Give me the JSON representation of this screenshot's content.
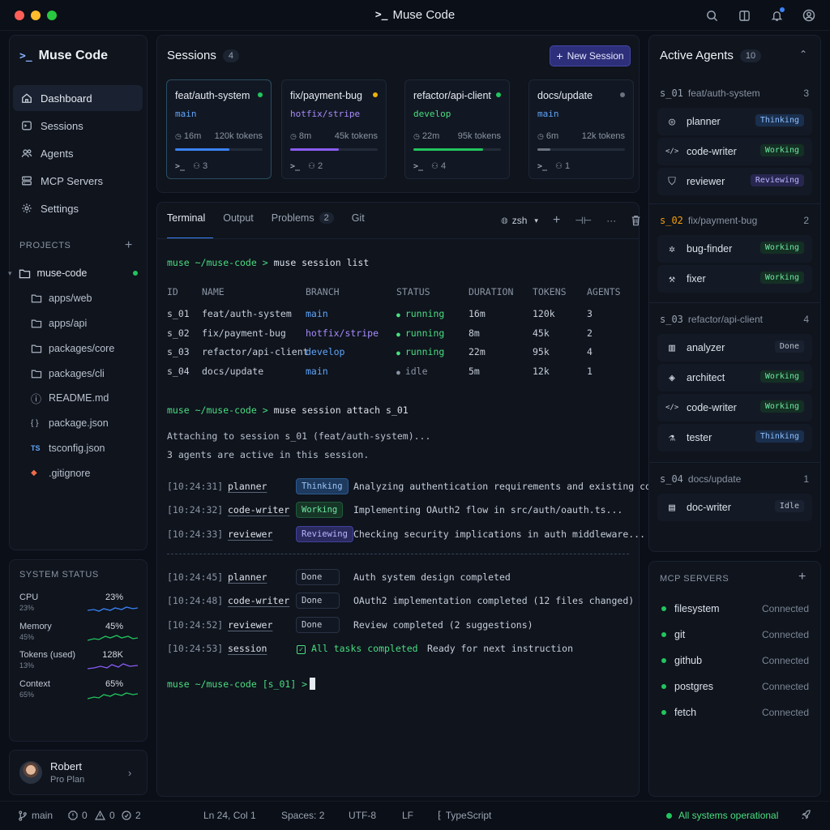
{
  "app": {
    "title": "Muse Code",
    "brand": "Muse Code"
  },
  "colors": {
    "accent": "#3b82f6",
    "green": "#22c55e",
    "yellow": "#eab308",
    "purple": "#8b5cf6",
    "gray": "#6b7280"
  },
  "nav": [
    {
      "label": "Dashboard",
      "icon": "home-icon"
    },
    {
      "label": "Sessions",
      "icon": "sessions-icon"
    },
    {
      "label": "Agents",
      "icon": "agents-icon"
    },
    {
      "label": "MCP Servers",
      "icon": "server-icon"
    },
    {
      "label": "Settings",
      "icon": "gear-icon"
    }
  ],
  "projects": {
    "label": "PROJECTS",
    "root": "muse-code",
    "items": [
      {
        "label": "apps/web",
        "icon": "folder-icon"
      },
      {
        "label": "apps/api",
        "icon": "folder-icon"
      },
      {
        "label": "packages/core",
        "icon": "folder-icon"
      },
      {
        "label": "packages/cli",
        "icon": "folder-icon"
      },
      {
        "label": "README.md",
        "icon": "info-icon",
        "glyph": "ⓘ"
      },
      {
        "label": "package.json",
        "icon": "json-icon",
        "glyph": "{ }"
      },
      {
        "label": "tsconfig.json",
        "icon": "ts-icon",
        "glyph": "TS"
      },
      {
        "label": ".gitignore",
        "icon": "git-icon",
        "glyph": "◆"
      }
    ]
  },
  "system_status": {
    "label": "SYSTEM STATUS",
    "rows": [
      {
        "label": "CPU",
        "sub": "23%",
        "value": "23%",
        "color": "#3b82f6"
      },
      {
        "label": "Memory",
        "sub": "45%",
        "value": "45%",
        "color": "#22c55e"
      },
      {
        "label": "Tokens (used)",
        "sub": "13%",
        "value": "128K",
        "color": "#8b5cf6"
      },
      {
        "label": "Context",
        "sub": "65%",
        "value": "65%",
        "color": "#22c55e"
      }
    ]
  },
  "user": {
    "name": "Robert",
    "plan": "Pro Plan"
  },
  "sessions": {
    "title": "Sessions",
    "count": "4",
    "new_label": "New Session",
    "cards": [
      {
        "name": "feat/auth-system",
        "branch": "main",
        "duration": "16m",
        "tokens": "120k tokens",
        "agents": "3",
        "progress": 0.62,
        "dot": "#22c55e",
        "bar": "#3b82f6",
        "branch_color": "#60a5fa"
      },
      {
        "name": "fix/payment-bug",
        "branch": "hotfix/stripe",
        "duration": "8m",
        "tokens": "45k tokens",
        "agents": "2",
        "progress": 0.56,
        "dot": "#eab308",
        "bar": "#8b5cf6",
        "branch_color": "#a78bfa"
      },
      {
        "name": "refactor/api-client",
        "branch": "develop",
        "duration": "22m",
        "tokens": "95k tokens",
        "agents": "4",
        "progress": 0.8,
        "dot": "#22c55e",
        "bar": "#22c55e",
        "branch_color": "#4ade80"
      },
      {
        "name": "docs/update",
        "branch": "main",
        "duration": "6m",
        "tokens": "12k tokens",
        "agents": "1",
        "progress": 0.15,
        "dot": "#6b7280",
        "bar": "#6b7280",
        "branch_color": "#60a5fa"
      }
    ]
  },
  "terminal": {
    "tabs": [
      "Terminal",
      "Output",
      "Problems",
      "Git"
    ],
    "problems_count": "2",
    "shell": "zsh",
    "prompt1": "muse ~/muse-code >",
    "cmd1": "muse session list",
    "headers": [
      "ID",
      "NAME",
      "BRANCH",
      "STATUS",
      "DURATION",
      "TOKENS",
      "AGENTS"
    ],
    "rows": [
      {
        "id": "s_01",
        "name": "feat/auth-system",
        "branch": "main",
        "status": "running",
        "duration": "16m",
        "tokens": "120k",
        "agents": "3"
      },
      {
        "id": "s_02",
        "name": "fix/payment-bug",
        "branch": "hotfix/stripe",
        "status": "running",
        "duration": "8m",
        "tokens": "45k",
        "agents": "2"
      },
      {
        "id": "s_03",
        "name": "refactor/api-client",
        "branch": "develop",
        "status": "running",
        "duration": "22m",
        "tokens": "95k",
        "agents": "4"
      },
      {
        "id": "s_04",
        "name": "docs/update",
        "branch": "main",
        "status": "idle",
        "duration": "5m",
        "tokens": "12k",
        "agents": "1"
      }
    ],
    "prompt2": "muse ~/muse-code >",
    "cmd2": "muse session attach s_01",
    "out1": "Attaching to session s_01 (feat/auth-system)...",
    "out2": "3 agents are active in this session.",
    "log1": [
      {
        "time": "[10:24:31]",
        "agent": "planner",
        "status": "Thinking",
        "msg": "Analyzing authentication requirements and existing codebase..."
      },
      {
        "time": "[10:24:32]",
        "agent": "code-writer",
        "status": "Working",
        "msg": "Implementing OAuth2 flow in src/auth/oauth.ts..."
      },
      {
        "time": "[10:24:33]",
        "agent": "reviewer",
        "status": "Reviewing",
        "msg": "Checking security implications in auth middleware..."
      }
    ],
    "log2": [
      {
        "time": "[10:24:45]",
        "agent": "planner",
        "status": "Done",
        "msg": "Auth system design completed"
      },
      {
        "time": "[10:24:48]",
        "agent": "code-writer",
        "status": "Done",
        "msg": "OAuth2 implementation completed (12 files changed)"
      },
      {
        "time": "[10:24:52]",
        "agent": "reviewer",
        "status": "Done",
        "msg": "Review completed (2 suggestions)"
      }
    ],
    "final": {
      "time": "[10:24:53]",
      "agent": "session",
      "status": "All tasks completed",
      "msg": "Ready for next instruction"
    },
    "prompt3": "muse ~/muse-code [s_01] >"
  },
  "active_agents": {
    "title": "Active Agents",
    "count": "10",
    "groups": [
      {
        "id": "s_01",
        "name": "feat/auth-system",
        "count": "3",
        "id_color": "#9aa4b2",
        "agents": [
          {
            "name": "planner",
            "status": "Thinking",
            "kind": "think",
            "icon": "brain-icon"
          },
          {
            "name": "code-writer",
            "status": "Working",
            "kind": "work",
            "icon": "code-icon"
          },
          {
            "name": "reviewer",
            "status": "Reviewing",
            "kind": "review",
            "icon": "shield-icon"
          }
        ]
      },
      {
        "id": "s_02",
        "name": "fix/payment-bug",
        "count": "2",
        "id_color": "#f59e0b",
        "agents": [
          {
            "name": "bug-finder",
            "status": "Working",
            "kind": "work",
            "icon": "bug-icon"
          },
          {
            "name": "fixer",
            "status": "Working",
            "kind": "work",
            "icon": "wrench-icon"
          }
        ]
      },
      {
        "id": "s_03",
        "name": "refactor/api-client",
        "count": "4",
        "id_color": "#9aa4b2",
        "agents": [
          {
            "name": "analyzer",
            "status": "Done",
            "kind": "done",
            "icon": "chart-icon"
          },
          {
            "name": "architect",
            "status": "Working",
            "kind": "work",
            "icon": "layers-icon"
          },
          {
            "name": "code-writer",
            "status": "Working",
            "kind": "work",
            "icon": "code-icon"
          },
          {
            "name": "tester",
            "status": "Thinking",
            "kind": "think",
            "icon": "flask-icon"
          }
        ]
      },
      {
        "id": "s_04",
        "name": "docs/update",
        "count": "1",
        "id_color": "#9aa4b2",
        "agents": [
          {
            "name": "doc-writer",
            "status": "Idle",
            "kind": "idle",
            "icon": "doc-icon"
          }
        ]
      }
    ]
  },
  "mcp": {
    "title": "MCP SERVERS",
    "servers": [
      {
        "name": "filesystem",
        "status": "Connected"
      },
      {
        "name": "git",
        "status": "Connected"
      },
      {
        "name": "github",
        "status": "Connected"
      },
      {
        "name": "postgres",
        "status": "Connected"
      },
      {
        "name": "fetch",
        "status": "Connected"
      }
    ]
  },
  "statusbar": {
    "branch": "main",
    "errors": "0",
    "warnings": "0",
    "agents": "2",
    "position": "Ln 24, Col 1",
    "spaces": "Spaces: 2",
    "encoding": "UTF-8",
    "eol": "LF",
    "language": "TypeScript",
    "system": "All systems operational"
  }
}
